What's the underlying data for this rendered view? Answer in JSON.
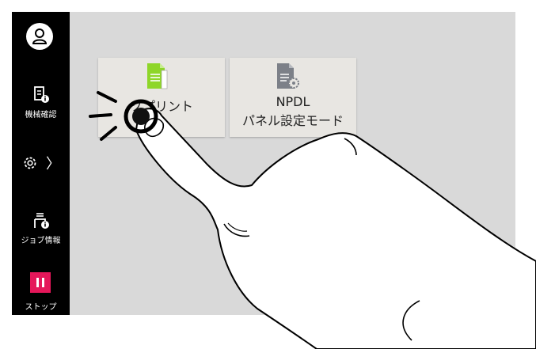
{
  "sidebar": {
    "machine_check_label": "機械確認",
    "job_info_label": "ジョブ情報",
    "stop_label": "ストップ",
    "settings_chevron": "〉"
  },
  "tiles": [
    {
      "label": "ソプリント",
      "icon": "green-document-icon"
    },
    {
      "label_line1": "NPDL",
      "label_line2": "パネル設定モード",
      "icon": "document-gear-icon"
    }
  ],
  "colors": {
    "sidebar_bg": "#000000",
    "screen_bg": "#d9d9d9",
    "tile_bg": "#e8e6e2",
    "stop_accent": "#e5175a",
    "doc_green": "#8ed629"
  }
}
